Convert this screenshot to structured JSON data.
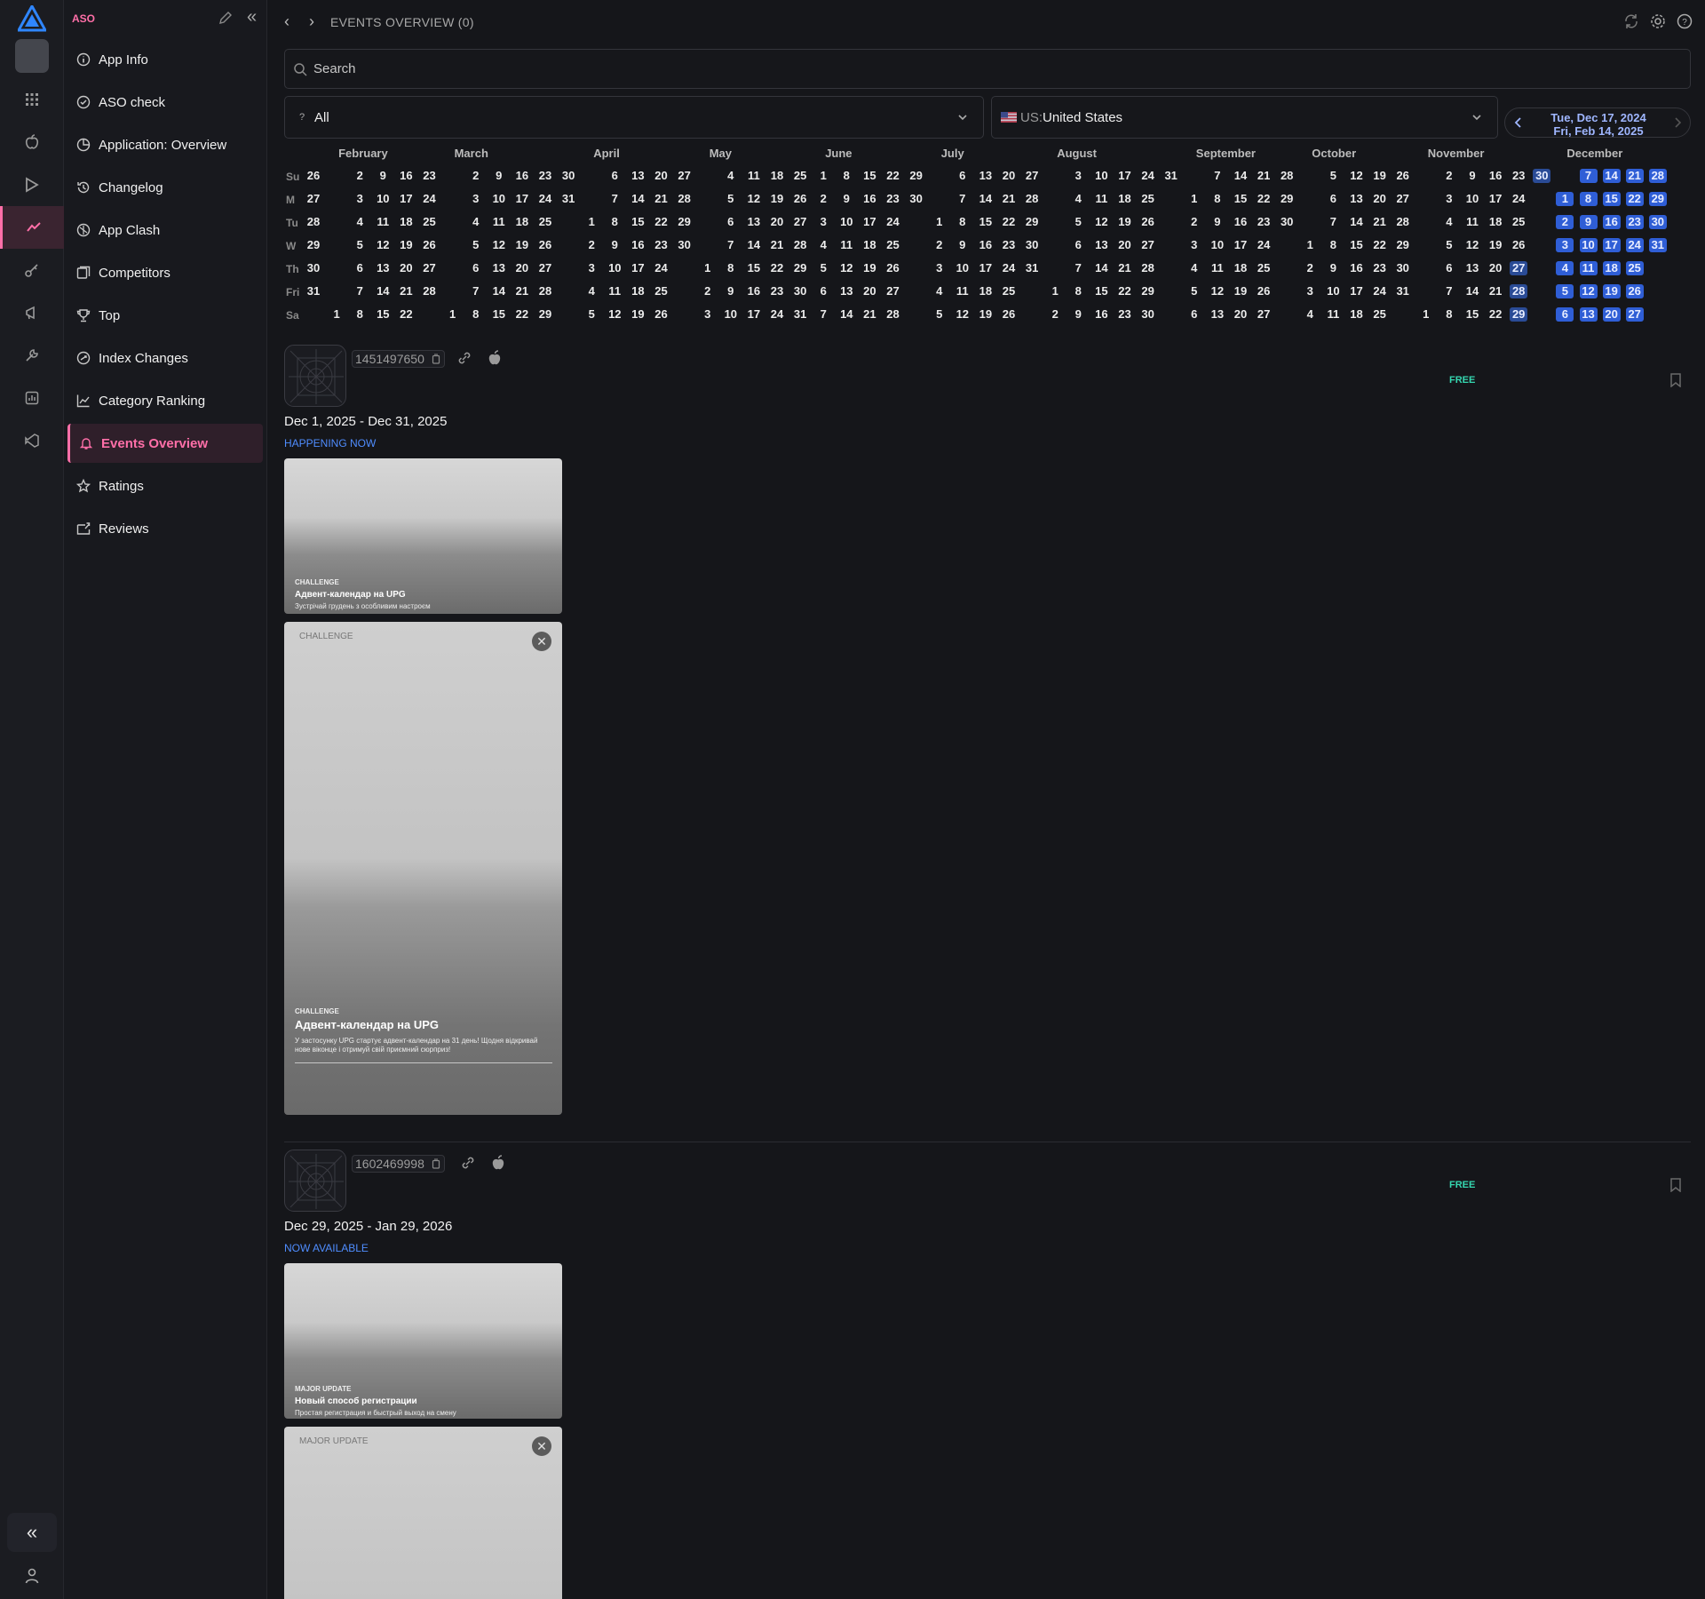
{
  "sidebar": {
    "section_title": "ASO",
    "items": [
      {
        "label": "App Info",
        "icon": "info-icon"
      },
      {
        "label": "ASO check",
        "icon": "check-circle-icon"
      },
      {
        "label": "Application: Overview",
        "icon": "pie-chart-icon"
      },
      {
        "label": "Changelog",
        "icon": "history-icon"
      },
      {
        "label": "App Clash",
        "icon": "clash-icon"
      },
      {
        "label": "Competitors",
        "icon": "competitors-icon"
      },
      {
        "label": "Top",
        "icon": "trophy-icon"
      },
      {
        "label": "Index Changes",
        "icon": "index-changes-icon"
      },
      {
        "label": "Category Ranking",
        "icon": "line-chart-icon"
      },
      {
        "label": "Events Overview",
        "icon": "bell-icon",
        "active": true
      },
      {
        "label": "Ratings",
        "icon": "star-icon"
      },
      {
        "label": "Reviews",
        "icon": "reviews-icon"
      }
    ]
  },
  "header": {
    "title": "EVENTS OVERVIEW (0)"
  },
  "search": {
    "placeholder": "Search"
  },
  "filters": {
    "type": {
      "prefix": "?",
      "value": "All"
    },
    "country": {
      "code": "US:",
      "value": "United States"
    }
  },
  "date_range": {
    "start": "Tue, Dec 17, 2024",
    "end": "Fri, Feb 14, 2025"
  },
  "calendar": {
    "weekdays": [
      "Su",
      "M",
      "Tu",
      "W",
      "Th",
      "Fri",
      "Sa"
    ],
    "months": [
      "February",
      "March",
      "April",
      "May",
      "June",
      "July",
      "August",
      "September",
      "October",
      "November",
      "December"
    ],
    "highlighted": [
      "Nov 27",
      "Nov 28",
      "Nov 29",
      "Nov 30",
      "Dec 1–31"
    ]
  },
  "events": [
    {
      "app_id": "1451497650",
      "price": "FREE",
      "dates": "Dec 1, 2025 - Dec 31, 2025",
      "status": "HAPPENING NOW",
      "card_small": {
        "tag": "CHALLENGE",
        "title": "Адвент-календар на UPG",
        "subtitle": "Зустрічай грудень з особливим настроєм"
      },
      "card_large": {
        "tag_top": "CHALLENGE",
        "tag": "CHALLENGE",
        "title": "Адвент-календар на UPG",
        "description": "У застосунку UPG стартує адвент-календар на 31 день! Щодня відкривай нове віконце і отримуй свій приємний сюрприз!"
      }
    },
    {
      "app_id": "1602469998",
      "price": "FREE",
      "dates": "Dec 29, 2025 - Jan 29, 2026",
      "status": "NOW AVAILABLE",
      "card_small": {
        "tag": "MAJOR UPDATE",
        "title": "Новый способ регистрации",
        "subtitle": "Простая регистрация и быстрый выход на смену"
      },
      "card_large": {
        "tag_top": "MAJOR UPDATE"
      }
    }
  ],
  "colors": {
    "accent": "#ff6fa8",
    "highlight": "#2f5ed6",
    "free": "#35d7b0",
    "status": "#4f8dff"
  }
}
